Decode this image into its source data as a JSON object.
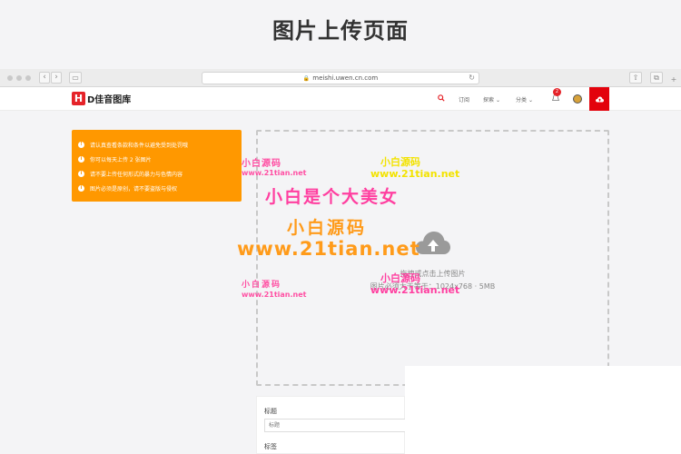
{
  "page": {
    "heading": "图片上传页面"
  },
  "browser": {
    "url": "meishi.uwen.cn.com",
    "back": "‹",
    "forward": "›"
  },
  "site": {
    "logo_mark": "H",
    "logo_text": "D佳音图库",
    "nav": {
      "subscribe": "订阅",
      "explore": "探索",
      "category": "分类"
    },
    "notification_count": "2"
  },
  "notice": {
    "items": [
      "请认真查看条款和条件以避免受到处罚哦",
      "你可以每天上传 2 张图片",
      "请不要上传任何形式的暴力与色情内容",
      "图片必须是原创，请不要盗版与侵权"
    ]
  },
  "dropzone": {
    "line1": "拖拽或点击上传图片",
    "line2": "图片必须大于等于：1024x768 · 5MB"
  },
  "form": {
    "title_label": "标题",
    "title_placeholder": "标题",
    "tags_label": "标签"
  },
  "watermarks": {
    "small_cn": "小白源码",
    "small_url": "www.21tian.net",
    "big_title": "小白是个大美女",
    "big_cn": "小白源码",
    "big_url": "www.21tian.net"
  },
  "colors": {
    "brand_red": "#e3020c",
    "notice_orange": "#ff9800",
    "wm_pink": "#ff4fa3",
    "wm_orange": "#ff9b1a",
    "wm_yellow": "#f3e300"
  }
}
